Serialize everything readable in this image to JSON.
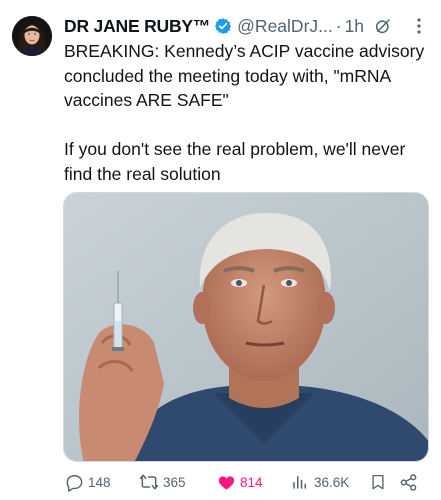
{
  "tweet": {
    "author_name": "DR JANE RUBY™",
    "handle": "@RealDrJ...",
    "separator": "·",
    "time": "1h",
    "body": [
      "BREAKING:  Kennedy’s ACIP vaccine advisory concluded the meeting today with, \"mRNA vaccines ARE SAFE\"",
      "If you don't see the real problem, we'll never find the real solution"
    ]
  },
  "actions": {
    "replies": "148",
    "reposts": "365",
    "likes": "814",
    "views": "36.6K"
  },
  "colors": {
    "text": "#0f1419",
    "secondary": "#536471",
    "verified": "#1d9bf0",
    "like": "#f91880",
    "border": "#cfd9de"
  },
  "icons": {
    "verified": "verified-badge-icon",
    "grok": "grok-icon",
    "more": "more-vertical-icon",
    "reply": "reply-icon",
    "repost": "repost-icon",
    "like": "heart-filled-icon",
    "views": "views-icon",
    "bookmark": "bookmark-icon",
    "share": "share-icon"
  }
}
